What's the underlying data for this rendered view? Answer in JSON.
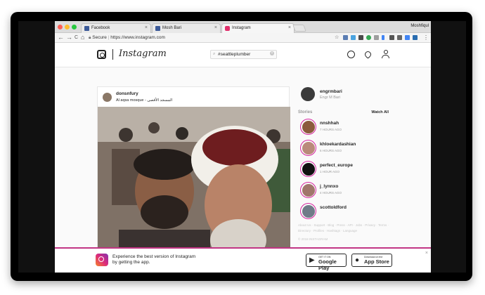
{
  "window": {
    "profile": "Moshfiqul"
  },
  "tabs": [
    {
      "label": "Facebook",
      "favicon_color": "#3b5998",
      "active": false
    },
    {
      "label": "Mosh Bari",
      "favicon_color": "#3b5998",
      "active": false
    },
    {
      "label": "Instagram",
      "favicon_color": "#e1306c",
      "active": true
    }
  ],
  "nav": {
    "back": "←",
    "forward": "→",
    "reload": "C",
    "home": "⌂"
  },
  "address": {
    "security": "Secure",
    "url": "https://www.instagram.com"
  },
  "instagram": {
    "wordmark": "Instagram",
    "search_value": "#seattleplumber",
    "icons": [
      "camera-icon",
      "compass-icon",
      "heart-icon",
      "person-icon"
    ]
  },
  "post": {
    "username": "donsnfury",
    "location": "Al aqsa mosque - المسجد الأقصى"
  },
  "sidebar": {
    "user": {
      "username": "engrmbari",
      "full_name": "Engr M Bari"
    },
    "stories_title": "Stories",
    "watch_all": "Watch All",
    "stories": [
      {
        "name": "nnshhah",
        "time": "7 HOURS AGO",
        "color": "#8b5a3c"
      },
      {
        "name": "khloekardashian",
        "time": "6 HOURS AGO",
        "color": "#b98a7a"
      },
      {
        "name": "perfect_europe",
        "time": "1 HOUR AGO",
        "color": "#111111"
      },
      {
        "name": "j_lynnxo",
        "time": "4 HOURS AGO",
        "color": "#a0766b"
      },
      {
        "name": "scottoldford",
        "time": "",
        "color": "#6f7b88"
      }
    ],
    "footer_links": "About Us · Support · Blog · Press · API · Jobs · Privacy · Terms · Directory · Profiles · Hashtags · Language",
    "copyright": "© 2018 INSTAGRAM"
  },
  "banner": {
    "text": "Experience the best version of Instagram by getting the app.",
    "google_small": "GET IT ON",
    "google_big": "Google Play",
    "apple_small": "Download on the",
    "apple_big": "App Store",
    "close": "×"
  }
}
